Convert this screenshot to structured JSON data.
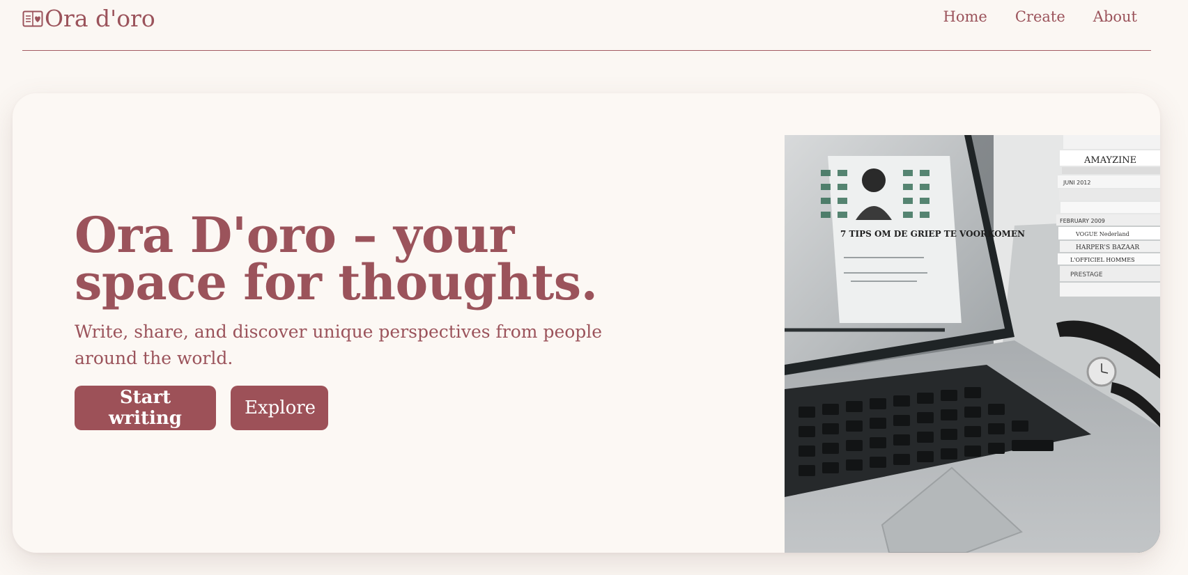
{
  "brand": {
    "name": "Ora d'oro",
    "icon": "book-heart-icon"
  },
  "nav": {
    "items": [
      "Home",
      "Create",
      "About"
    ]
  },
  "hero": {
    "title": "Ora D'oro – your space for thoughts.",
    "subtitle": "Write, share, and discover unique perspectives from people around the world.",
    "primary_button": "Start writing",
    "secondary_button": "Explore",
    "image": {
      "screen_headline": "7 TIPS OM DE GRIEP TE VOORKOMEN",
      "magazine_spines": [
        "AMAYZINE",
        "JUNI 2012",
        "FEBRUARY 2009",
        "VOGUE Nederland",
        "HARPER'S BAZAAR",
        "L'OFFICIEL HOMMES",
        "PRESTAGE"
      ]
    }
  },
  "colors": {
    "accent": "#9b535b",
    "background": "#fbf7f3",
    "button": "#9d5158"
  }
}
